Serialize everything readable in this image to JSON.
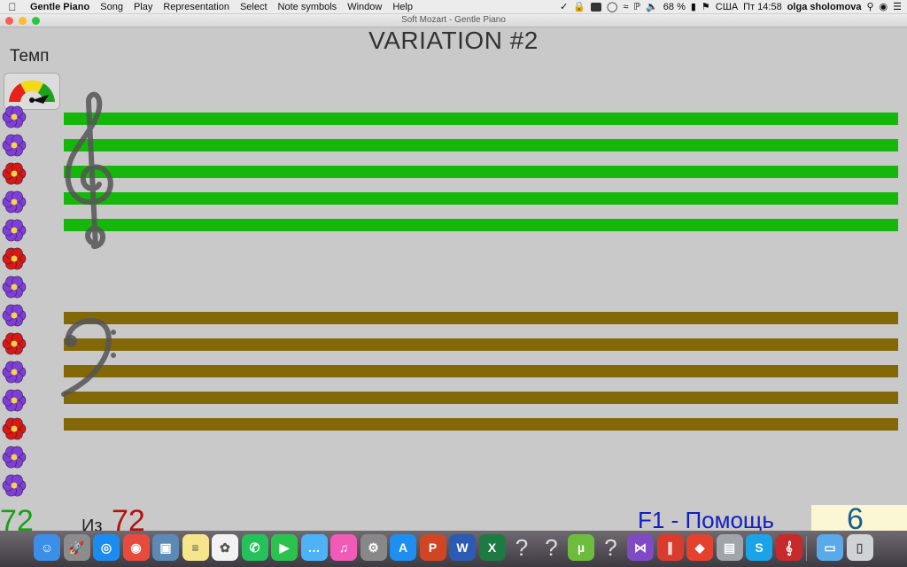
{
  "menubar": {
    "app_name": "Gentle Piano",
    "items": [
      "Song",
      "Play",
      "Representation",
      "Select",
      "Note symbols",
      "Window",
      "Help"
    ],
    "battery": "68 %",
    "input_source": "США",
    "clock": "Пт 14:58",
    "user": "olga sholomova"
  },
  "window": {
    "title": "Soft Mozart - Gentle Piano"
  },
  "main": {
    "variation_title": "VARIATION #2",
    "tempo_label": "Темп"
  },
  "colors": {
    "treble_staff": "#15b80a",
    "bass_staff": "#836808",
    "flower_purple": "#7d3fd6",
    "flower_red": "#d8190f"
  },
  "flowers": [
    "purple",
    "purple",
    "red",
    "purple",
    "purple",
    "red",
    "purple",
    "purple",
    "red",
    "purple",
    "purple",
    "red",
    "purple",
    "purple"
  ],
  "status": {
    "current": "72",
    "of_label": "Из",
    "total": "72",
    "help_text": "F1 - Помощь",
    "score": "6"
  },
  "dock": {
    "apps": [
      {
        "icon": "finder-icon",
        "color": "#3b8fe8"
      },
      {
        "icon": "launchpad-icon",
        "color": "#8c8c8c"
      },
      {
        "icon": "safari-icon",
        "color": "#1a8cf0"
      },
      {
        "icon": "chrome-icon",
        "color": "#e84b3c"
      },
      {
        "icon": "preview-icon",
        "color": "#5c8ab5"
      },
      {
        "icon": "notes-icon",
        "color": "#f7e58c"
      },
      {
        "icon": "photos-icon",
        "color": "#f2f2f2"
      },
      {
        "icon": "whatsapp-icon",
        "color": "#25c15a"
      },
      {
        "icon": "facetime-icon",
        "color": "#2cc24e"
      },
      {
        "icon": "messages-icon",
        "color": "#4eb2f7"
      },
      {
        "icon": "itunes-icon",
        "color": "#f25ab8"
      },
      {
        "icon": "system-preferences-icon",
        "color": "#888888"
      },
      {
        "icon": "app-store-icon",
        "color": "#1e8ef0"
      },
      {
        "icon": "powerpoint-icon",
        "color": "#d04524"
      },
      {
        "icon": "word-icon",
        "color": "#2b5bb3"
      },
      {
        "icon": "excel-icon",
        "color": "#1e7a43"
      },
      {
        "icon": "unknown-app-icon",
        "color": "transparent"
      },
      {
        "icon": "unknown-app-icon",
        "color": "transparent"
      },
      {
        "icon": "utorrent-icon",
        "color": "#6cbd3c"
      },
      {
        "icon": "unknown-app-icon",
        "color": "transparent"
      },
      {
        "icon": "visual-studio-icon",
        "color": "#7f4ac4"
      },
      {
        "icon": "parallels-icon",
        "color": "#d93b2d"
      },
      {
        "icon": "anydesk-icon",
        "color": "#e4412f"
      },
      {
        "icon": "image-capture-icon",
        "color": "#9fa5ab"
      },
      {
        "icon": "skype-icon",
        "color": "#1aa3e6"
      },
      {
        "icon": "gentle-piano-icon",
        "color": "#c62a2a"
      },
      {
        "icon": "downloads-folder-icon",
        "color": "#5aa9e8"
      },
      {
        "icon": "trash-icon",
        "color": "#d0d3d6"
      }
    ]
  }
}
